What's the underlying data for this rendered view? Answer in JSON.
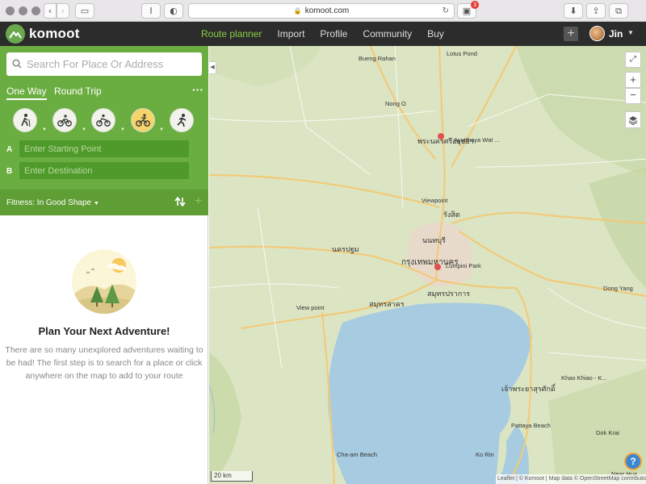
{
  "browser": {
    "url": "komoot.com",
    "notification_count": "3"
  },
  "header": {
    "logo": "komoot",
    "nav": [
      "Route planner",
      "Import",
      "Profile",
      "Community",
      "Buy"
    ],
    "active_nav": "Route planner",
    "user": "Jin"
  },
  "sidebar": {
    "search_placeholder": "Search For Place Or Address",
    "tabs": [
      "One Way",
      "Round Trip"
    ],
    "sports": [
      "hiking",
      "bike-touring",
      "mountain-biking",
      "road-cycling",
      "running"
    ],
    "start_label": "A",
    "start_placeholder": "Enter Starting Point",
    "dest_label": "B",
    "dest_placeholder": "Enter Destination",
    "fitness": "Fitness: In Good Shape",
    "adventure_title": "Plan Your Next Adventure!",
    "adventure_text": "There are so many unexplored adventures waiting to be had! The first step is to search for a place or click anywhere on the map to add to your route"
  },
  "map": {
    "places": [
      "Lotus Pond",
      "Bueng Rahan",
      "Nong O",
      "พระนครศรีอยุธยา",
      "Ayutthaya Wat ...",
      "Viewpoint",
      "รังสิต",
      "นนทบุรี",
      "นครปฐม",
      "กรุงเทพมหานคร",
      "Lumpini Park",
      "สมุทรสาคร",
      "สมุทรปราการ",
      "View point",
      "Dong Yang",
      "Khao Khiao - K...",
      "เจ้าพระยาสุรศักดิ์",
      "Pattaya Beach",
      "Dok Krai",
      "Cha-am Beach",
      "Ko Rin",
      "Near Hua..."
    ],
    "scale": "20 km",
    "attribution": "Leaflet | © Komoot | Map data © OpenStreetMap contributors",
    "help": "?"
  },
  "colors": {
    "brand": "#6aad40",
    "header": "#2c2c2c",
    "active_nav": "#8ccf45",
    "water": "#a7cbe0"
  }
}
